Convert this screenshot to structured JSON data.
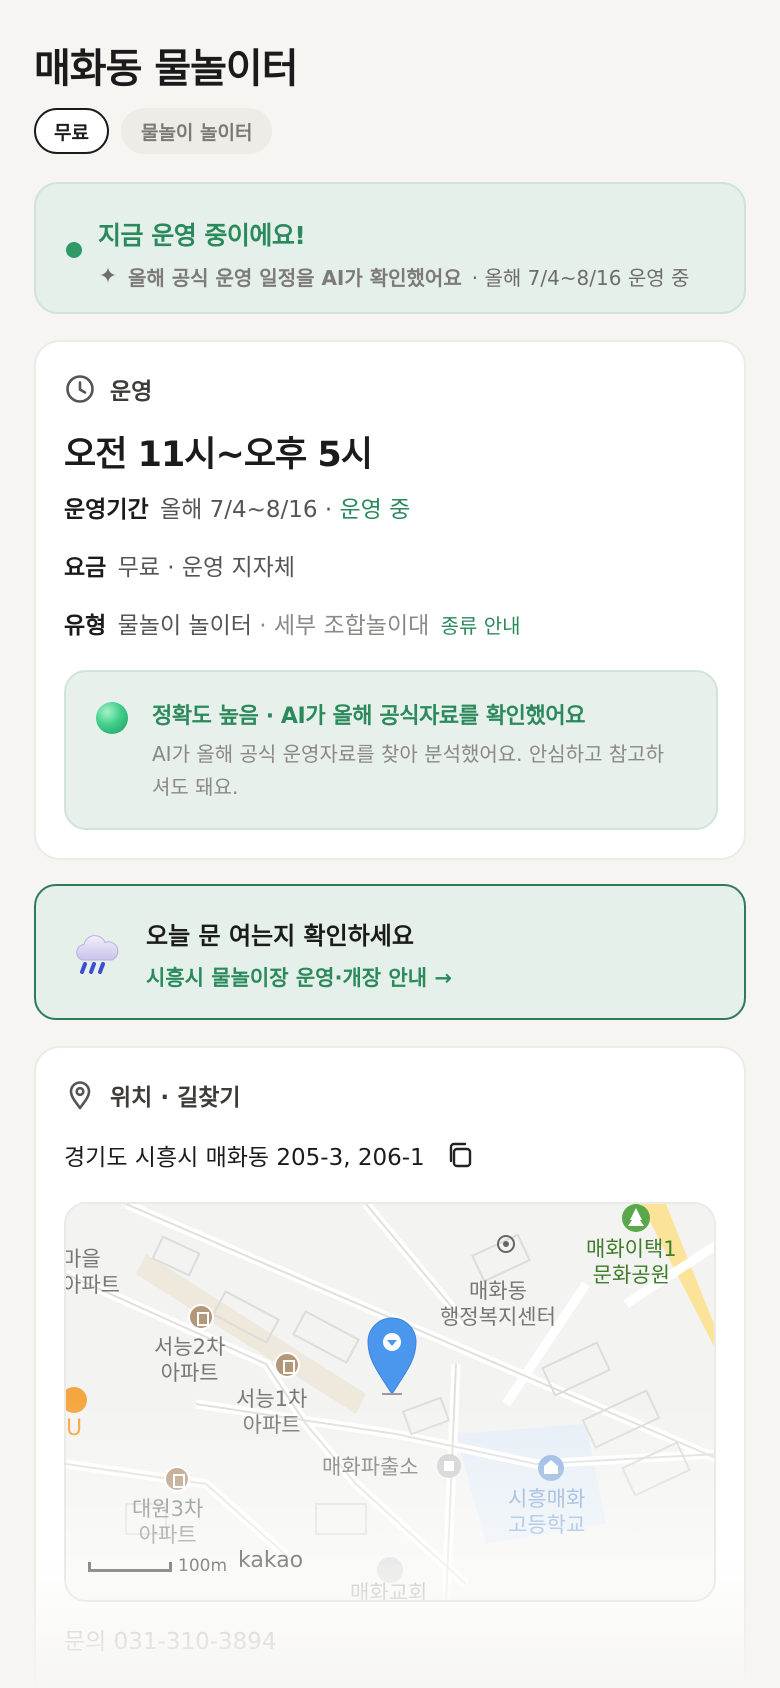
{
  "header": {
    "title": "매화동 물놀이터",
    "chips": [
      "무료",
      "물놀이 놀이터"
    ]
  },
  "status": {
    "title": "지금 운영 중이에요!",
    "sub_bold": "올해 공식 운영 일정을 AI가 확인했어요",
    "sub_rest": "· 올해 7/4~8/16 운영 중"
  },
  "hours": {
    "section": "운영",
    "hours": "오전 11시~오후 5시",
    "period_label": "운영기간",
    "period_value": "올해 7/4~8/16 ·",
    "period_status": "운영 중",
    "fee_label": "요금",
    "fee_value": "무료 · 운영 지자체",
    "type_label": "유형",
    "type_value": "물놀이 놀이터",
    "type_detail": "· 세부 조합놀이대",
    "type_link": "종류 안내",
    "accuracy_title": "정확도 높음 · AI가 올해 공식자료를 확인했어요",
    "accuracy_desc": "AI가 올해 공식 운영자료를 찾아 분석했어요. 안심하고 참고하셔도 돼요."
  },
  "notice": {
    "title": "오늘 문 여는지 확인하세요",
    "link": "시흥시 물놀이장 운영·개장 안내 →",
    "icon": "rain-cloud-icon"
  },
  "location": {
    "section": "위치 · 길찾기",
    "address": "경기도 시흥시 매화동 205-3, 206-1",
    "map": {
      "labels": {
        "village": "마을\n아파트",
        "seoneung2": "서능2차\n아파트",
        "seoneung1": "서능1차\n아파트",
        "welfare": "매화동\n행정복지센터",
        "park": "매화이택1\n문화공원",
        "police": "매화파출소",
        "school": "시흥매화\n고등학교",
        "daewon": "대원3차\n아파트",
        "church": "매화교회",
        "edge": "U"
      },
      "scale": "100m",
      "brand": "kakao"
    },
    "contact": "문의 031-310-3894"
  },
  "colors": {
    "accent_green": "#2b8a5c",
    "status_bg": "#e6f0eb",
    "pin": "#4c97ee"
  }
}
